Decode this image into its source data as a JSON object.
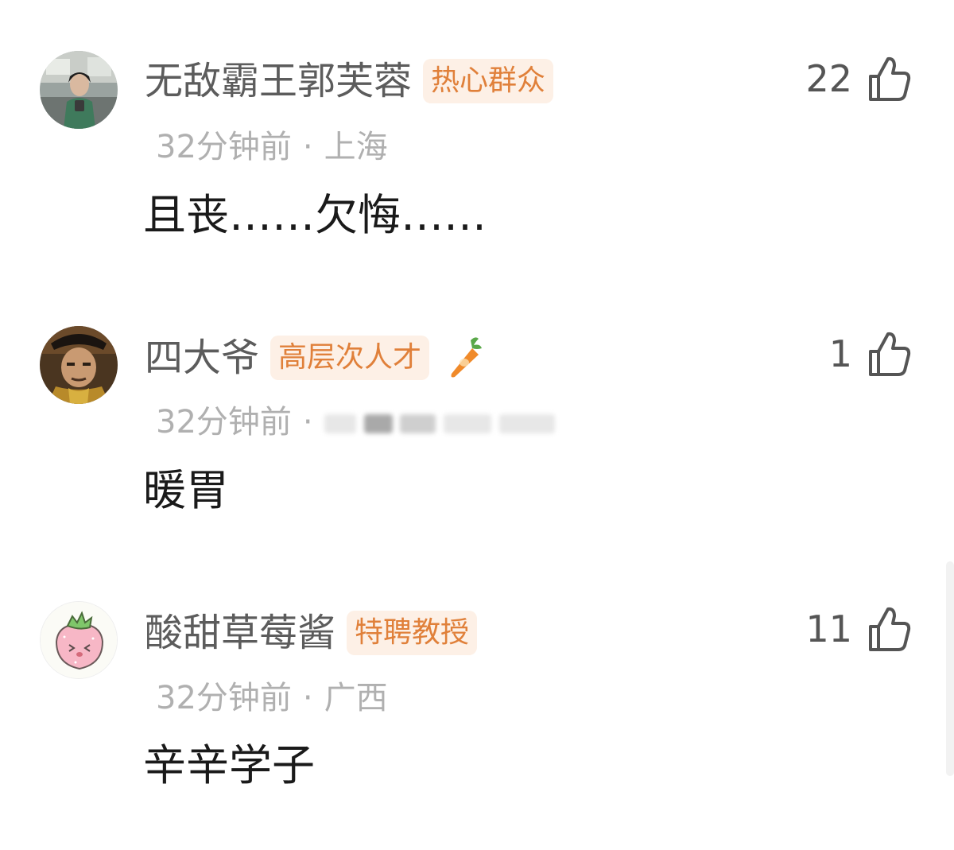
{
  "comments": [
    {
      "username": "无敌霸王郭芙蓉",
      "badge": "热心群众",
      "time": "32分钟前",
      "separator": "·",
      "location": "上海",
      "text": "且丧……欠悔……",
      "likes": "22",
      "avatar_icon": "avatar-photo-woman-office"
    },
    {
      "username": "四大爷",
      "badge": "高层次人才",
      "time": "32分钟前",
      "separator": "·",
      "location": "",
      "text": "暖胃",
      "likes": "1",
      "avatar_icon": "avatar-photo-qing-official",
      "extra_icon": "carrot-icon"
    },
    {
      "username": "酸甜草莓酱",
      "badge": "特聘教授",
      "time": "32分钟前",
      "separator": "·",
      "location": "广西",
      "text": "辛辛学子",
      "likes": "11",
      "avatar_icon": "avatar-strawberry-cartoon"
    }
  ],
  "colors": {
    "username": "#5c5c5c",
    "badge_text": "#e0803a",
    "badge_bg": "#fdf0e6",
    "meta": "#b0b0b0",
    "content": "#1a1a1a",
    "like_icon": "#555555"
  }
}
